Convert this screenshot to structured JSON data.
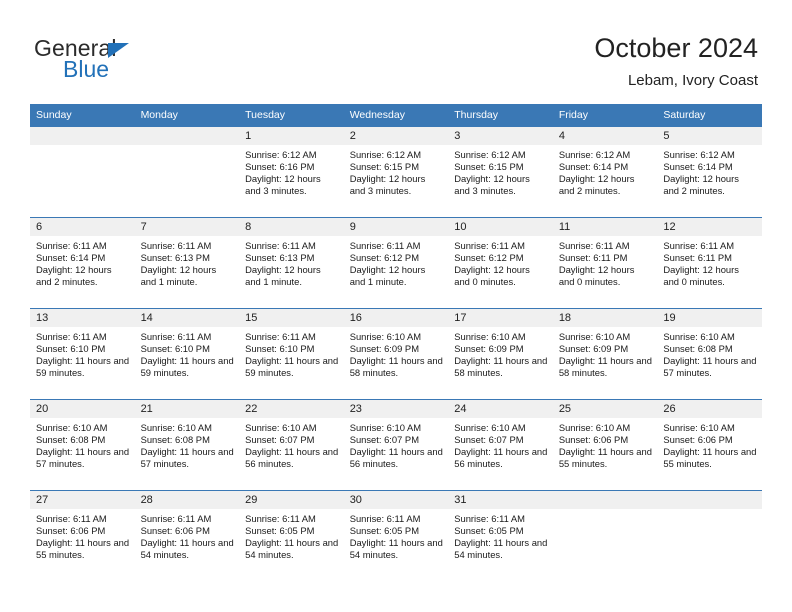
{
  "brand": {
    "name_top": "General",
    "name_bottom": "Blue",
    "triangle_color": "#2271b8"
  },
  "header": {
    "title": "October 2024",
    "subtitle": "Lebam, Ivory Coast",
    "accent_color": "#3a78b5",
    "daynum_band_color": "#f0f0f0"
  },
  "weekdays": [
    "Sunday",
    "Monday",
    "Tuesday",
    "Wednesday",
    "Thursday",
    "Friday",
    "Saturday"
  ],
  "labels": {
    "sunrise_prefix": "Sunrise: ",
    "sunset_prefix": "Sunset: ",
    "daylight_prefix": "Daylight: "
  },
  "weeks": [
    [
      {
        "day": "",
        "empty": true
      },
      {
        "day": "",
        "empty": true
      },
      {
        "day": "1",
        "sunrise": "Sunrise: 6:12 AM",
        "sunset": "Sunset: 6:16 PM",
        "daylight": "Daylight: 12 hours and 3 minutes."
      },
      {
        "day": "2",
        "sunrise": "Sunrise: 6:12 AM",
        "sunset": "Sunset: 6:15 PM",
        "daylight": "Daylight: 12 hours and 3 minutes."
      },
      {
        "day": "3",
        "sunrise": "Sunrise: 6:12 AM",
        "sunset": "Sunset: 6:15 PM",
        "daylight": "Daylight: 12 hours and 3 minutes."
      },
      {
        "day": "4",
        "sunrise": "Sunrise: 6:12 AM",
        "sunset": "Sunset: 6:14 PM",
        "daylight": "Daylight: 12 hours and 2 minutes."
      },
      {
        "day": "5",
        "sunrise": "Sunrise: 6:12 AM",
        "sunset": "Sunset: 6:14 PM",
        "daylight": "Daylight: 12 hours and 2 minutes."
      }
    ],
    [
      {
        "day": "6",
        "sunrise": "Sunrise: 6:11 AM",
        "sunset": "Sunset: 6:14 PM",
        "daylight": "Daylight: 12 hours and 2 minutes."
      },
      {
        "day": "7",
        "sunrise": "Sunrise: 6:11 AM",
        "sunset": "Sunset: 6:13 PM",
        "daylight": "Daylight: 12 hours and 1 minute."
      },
      {
        "day": "8",
        "sunrise": "Sunrise: 6:11 AM",
        "sunset": "Sunset: 6:13 PM",
        "daylight": "Daylight: 12 hours and 1 minute."
      },
      {
        "day": "9",
        "sunrise": "Sunrise: 6:11 AM",
        "sunset": "Sunset: 6:12 PM",
        "daylight": "Daylight: 12 hours and 1 minute."
      },
      {
        "day": "10",
        "sunrise": "Sunrise: 6:11 AM",
        "sunset": "Sunset: 6:12 PM",
        "daylight": "Daylight: 12 hours and 0 minutes."
      },
      {
        "day": "11",
        "sunrise": "Sunrise: 6:11 AM",
        "sunset": "Sunset: 6:11 PM",
        "daylight": "Daylight: 12 hours and 0 minutes."
      },
      {
        "day": "12",
        "sunrise": "Sunrise: 6:11 AM",
        "sunset": "Sunset: 6:11 PM",
        "daylight": "Daylight: 12 hours and 0 minutes."
      }
    ],
    [
      {
        "day": "13",
        "sunrise": "Sunrise: 6:11 AM",
        "sunset": "Sunset: 6:10 PM",
        "daylight": "Daylight: 11 hours and 59 minutes."
      },
      {
        "day": "14",
        "sunrise": "Sunrise: 6:11 AM",
        "sunset": "Sunset: 6:10 PM",
        "daylight": "Daylight: 11 hours and 59 minutes."
      },
      {
        "day": "15",
        "sunrise": "Sunrise: 6:11 AM",
        "sunset": "Sunset: 6:10 PM",
        "daylight": "Daylight: 11 hours and 59 minutes."
      },
      {
        "day": "16",
        "sunrise": "Sunrise: 6:10 AM",
        "sunset": "Sunset: 6:09 PM",
        "daylight": "Daylight: 11 hours and 58 minutes."
      },
      {
        "day": "17",
        "sunrise": "Sunrise: 6:10 AM",
        "sunset": "Sunset: 6:09 PM",
        "daylight": "Daylight: 11 hours and 58 minutes."
      },
      {
        "day": "18",
        "sunrise": "Sunrise: 6:10 AM",
        "sunset": "Sunset: 6:09 PM",
        "daylight": "Daylight: 11 hours and 58 minutes."
      },
      {
        "day": "19",
        "sunrise": "Sunrise: 6:10 AM",
        "sunset": "Sunset: 6:08 PM",
        "daylight": "Daylight: 11 hours and 57 minutes."
      }
    ],
    [
      {
        "day": "20",
        "sunrise": "Sunrise: 6:10 AM",
        "sunset": "Sunset: 6:08 PM",
        "daylight": "Daylight: 11 hours and 57 minutes."
      },
      {
        "day": "21",
        "sunrise": "Sunrise: 6:10 AM",
        "sunset": "Sunset: 6:08 PM",
        "daylight": "Daylight: 11 hours and 57 minutes."
      },
      {
        "day": "22",
        "sunrise": "Sunrise: 6:10 AM",
        "sunset": "Sunset: 6:07 PM",
        "daylight": "Daylight: 11 hours and 56 minutes."
      },
      {
        "day": "23",
        "sunrise": "Sunrise: 6:10 AM",
        "sunset": "Sunset: 6:07 PM",
        "daylight": "Daylight: 11 hours and 56 minutes."
      },
      {
        "day": "24",
        "sunrise": "Sunrise: 6:10 AM",
        "sunset": "Sunset: 6:07 PM",
        "daylight": "Daylight: 11 hours and 56 minutes."
      },
      {
        "day": "25",
        "sunrise": "Sunrise: 6:10 AM",
        "sunset": "Sunset: 6:06 PM",
        "daylight": "Daylight: 11 hours and 55 minutes."
      },
      {
        "day": "26",
        "sunrise": "Sunrise: 6:10 AM",
        "sunset": "Sunset: 6:06 PM",
        "daylight": "Daylight: 11 hours and 55 minutes."
      }
    ],
    [
      {
        "day": "27",
        "sunrise": "Sunrise: 6:11 AM",
        "sunset": "Sunset: 6:06 PM",
        "daylight": "Daylight: 11 hours and 55 minutes."
      },
      {
        "day": "28",
        "sunrise": "Sunrise: 6:11 AM",
        "sunset": "Sunset: 6:06 PM",
        "daylight": "Daylight: 11 hours and 54 minutes."
      },
      {
        "day": "29",
        "sunrise": "Sunrise: 6:11 AM",
        "sunset": "Sunset: 6:05 PM",
        "daylight": "Daylight: 11 hours and 54 minutes."
      },
      {
        "day": "30",
        "sunrise": "Sunrise: 6:11 AM",
        "sunset": "Sunset: 6:05 PM",
        "daylight": "Daylight: 11 hours and 54 minutes."
      },
      {
        "day": "31",
        "sunrise": "Sunrise: 6:11 AM",
        "sunset": "Sunset: 6:05 PM",
        "daylight": "Daylight: 11 hours and 54 minutes."
      },
      {
        "day": "",
        "empty": true
      },
      {
        "day": "",
        "empty": true
      }
    ]
  ]
}
